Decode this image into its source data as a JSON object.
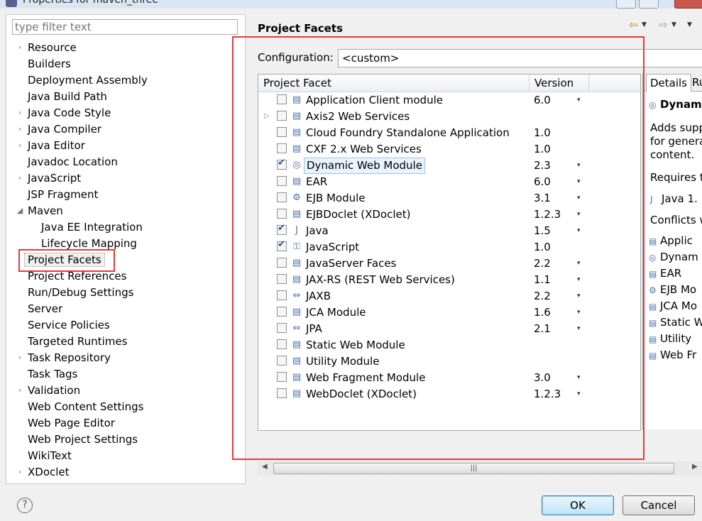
{
  "window": {
    "title": "Properties for maven_three"
  },
  "filter": {
    "placeholder": "type filter text"
  },
  "tree": {
    "items": [
      {
        "label": "Resource",
        "arrow": "›",
        "indent": 0
      },
      {
        "label": "Builders",
        "arrow": "",
        "indent": 0
      },
      {
        "label": "Deployment Assembly",
        "arrow": "",
        "indent": 0
      },
      {
        "label": "Java Build Path",
        "arrow": "",
        "indent": 0
      },
      {
        "label": "Java Code Style",
        "arrow": "›",
        "indent": 0
      },
      {
        "label": "Java Compiler",
        "arrow": "›",
        "indent": 0
      },
      {
        "label": "Java Editor",
        "arrow": "›",
        "indent": 0
      },
      {
        "label": "Javadoc Location",
        "arrow": "",
        "indent": 0
      },
      {
        "label": "JavaScript",
        "arrow": "›",
        "indent": 0
      },
      {
        "label": "JSP Fragment",
        "arrow": "",
        "indent": 0
      },
      {
        "label": "Maven",
        "arrow": "◢",
        "indent": 0
      },
      {
        "label": "Java EE Integration",
        "arrow": "",
        "indent": 1
      },
      {
        "label": "Lifecycle Mapping",
        "arrow": "",
        "indent": 1
      },
      {
        "label": "Project Facets",
        "arrow": "",
        "indent": 0,
        "selected": true
      },
      {
        "label": "Project References",
        "arrow": "",
        "indent": 0
      },
      {
        "label": "Run/Debug Settings",
        "arrow": "",
        "indent": 0
      },
      {
        "label": "Server",
        "arrow": "",
        "indent": 0
      },
      {
        "label": "Service Policies",
        "arrow": "",
        "indent": 0
      },
      {
        "label": "Targeted Runtimes",
        "arrow": "",
        "indent": 0
      },
      {
        "label": "Task Repository",
        "arrow": "›",
        "indent": 0
      },
      {
        "label": "Task Tags",
        "arrow": "",
        "indent": 0
      },
      {
        "label": "Validation",
        "arrow": "›",
        "indent": 0
      },
      {
        "label": "Web Content Settings",
        "arrow": "",
        "indent": 0
      },
      {
        "label": "Web Page Editor",
        "arrow": "",
        "indent": 0
      },
      {
        "label": "Web Project Settings",
        "arrow": "",
        "indent": 0
      },
      {
        "label": "WikiText",
        "arrow": "",
        "indent": 0
      },
      {
        "label": "XDoclet",
        "arrow": "›",
        "indent": 0
      }
    ]
  },
  "main": {
    "title": "Project Facets",
    "config_label": "Configuration:",
    "config_value": "<custom>",
    "facet_header": {
      "name": "Project Facet",
      "version": "Version"
    },
    "facets": [
      {
        "name": "Application Client module",
        "version": "6.0",
        "checked": false,
        "dropdown": true,
        "icon": "page-icon",
        "expander": false
      },
      {
        "name": "Axis2 Web Services",
        "version": "",
        "checked": false,
        "dropdown": false,
        "icon": "page-icon",
        "expander": true
      },
      {
        "name": "Cloud Foundry Standalone Application",
        "version": "1.0",
        "checked": false,
        "dropdown": false,
        "icon": "page-icon",
        "expander": false
      },
      {
        "name": "CXF 2.x Web Services",
        "version": "1.0",
        "checked": false,
        "dropdown": false,
        "icon": "page-icon",
        "expander": false
      },
      {
        "name": "Dynamic Web Module",
        "version": "2.3",
        "checked": true,
        "dropdown": true,
        "icon": "globe-icon",
        "expander": false,
        "focused": true
      },
      {
        "name": "EAR",
        "version": "6.0",
        "checked": false,
        "dropdown": true,
        "icon": "page-icon",
        "expander": false
      },
      {
        "name": "EJB Module",
        "version": "3.1",
        "checked": false,
        "dropdown": true,
        "icon": "bean-icon",
        "expander": false
      },
      {
        "name": "EJBDoclet (XDoclet)",
        "version": "1.2.3",
        "checked": false,
        "dropdown": true,
        "icon": "page-icon",
        "expander": false
      },
      {
        "name": "Java",
        "version": "1.5",
        "checked": true,
        "dropdown": true,
        "icon": "java-icon",
        "expander": false
      },
      {
        "name": "JavaScript",
        "version": "1.0",
        "checked": true,
        "dropdown": false,
        "icon": "js-icon",
        "expander": false
      },
      {
        "name": "JavaServer Faces",
        "version": "2.2",
        "checked": false,
        "dropdown": true,
        "icon": "page-icon",
        "expander": false
      },
      {
        "name": "JAX-RS (REST Web Services)",
        "version": "1.1",
        "checked": false,
        "dropdown": true,
        "icon": "page-icon",
        "expander": false
      },
      {
        "name": "JAXB",
        "version": "2.2",
        "checked": false,
        "dropdown": true,
        "icon": "arrows-icon",
        "expander": false
      },
      {
        "name": "JCA Module",
        "version": "1.6",
        "checked": false,
        "dropdown": true,
        "icon": "page-icon",
        "expander": false
      },
      {
        "name": "JPA",
        "version": "2.1",
        "checked": false,
        "dropdown": true,
        "icon": "arrows-icon",
        "expander": false
      },
      {
        "name": "Static Web Module",
        "version": "",
        "checked": false,
        "dropdown": false,
        "icon": "page-icon",
        "expander": false
      },
      {
        "name": "Utility Module",
        "version": "",
        "checked": false,
        "dropdown": false,
        "icon": "page-icon",
        "expander": false
      },
      {
        "name": "Web Fragment Module",
        "version": "3.0",
        "checked": false,
        "dropdown": true,
        "icon": "page-icon",
        "expander": false
      },
      {
        "name": "WebDoclet (XDoclet)",
        "version": "1.2.3",
        "checked": false,
        "dropdown": true,
        "icon": "page-icon",
        "expander": false
      }
    ]
  },
  "details": {
    "tabs": [
      "Details",
      "Ru"
    ],
    "heading": "Dynam",
    "desc_lines": [
      "Adds supp",
      "for genera",
      "content."
    ],
    "requires_label": "Requires t",
    "requires_item": "Java 1.",
    "conflicts_label": "Conflicts w",
    "conflicts": [
      "Applic",
      "Dynam",
      "EAR",
      "EJB Mo",
      "JCA Mo",
      "Static W",
      "Utility",
      "Web Fr"
    ]
  },
  "buttons": {
    "ok": "OK",
    "cancel": "Cancel",
    "help": "?"
  },
  "colors": {
    "highlight": "#e23b3b",
    "accent": "#3c7fb1"
  }
}
